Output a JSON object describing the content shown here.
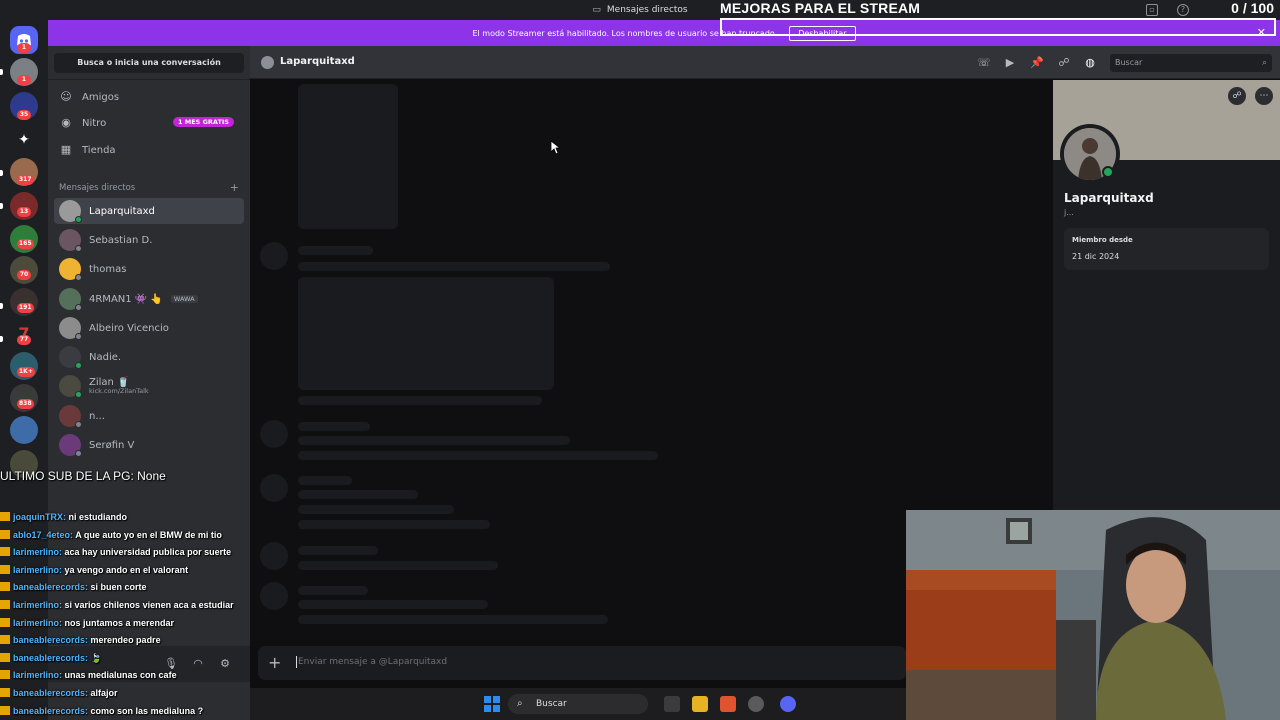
{
  "titlebar": {
    "title": "Mensajes directos"
  },
  "overlay": {
    "headline": "MEJORAS PARA EL STREAM",
    "counter": "0 / 100",
    "last_sub": "ULTIMO SUB DE LA PG: None"
  },
  "banner": {
    "text": "El modo Streamer está habilitado. Los nombres de usuario se han truncado.",
    "disable_label": "Deshabilitar"
  },
  "servers": [
    {
      "badge": "1"
    },
    {
      "badge": "1"
    },
    {
      "badge": "35"
    },
    {
      "badge": ""
    },
    {
      "badge": "317"
    },
    {
      "badge": "13"
    },
    {
      "badge": "165"
    },
    {
      "badge": "70"
    },
    {
      "badge": "191"
    },
    {
      "badge": "77"
    },
    {
      "badge": "1K+"
    },
    {
      "badge": "838"
    },
    {
      "badge": ""
    }
  ],
  "sidebar": {
    "search_label": "Busca o inicia una conversación",
    "nav": {
      "friends": "Amigos",
      "nitro": "Nitro",
      "nitro_badge": "1 MES GRATIS",
      "shop": "Tienda"
    },
    "dm_header": "Mensajes directos",
    "dm_add": "+",
    "dms": [
      {
        "name": "Laparquitaxd",
        "sub": "",
        "tag": ""
      },
      {
        "name": "Sebastian D.",
        "sub": "",
        "tag": ""
      },
      {
        "name": "thomas",
        "sub": "",
        "tag": ""
      },
      {
        "name": "4RMAN1 👾 👆",
        "sub": "",
        "tag": "WAWA"
      },
      {
        "name": "Albeiro Vicencio",
        "sub": "",
        "tag": ""
      },
      {
        "name": "Nadie.",
        "sub": "",
        "tag": ""
      },
      {
        "name": "Zilan 🥤",
        "sub": "kick.com/ZilanTalk",
        "tag": ""
      },
      {
        "name": "n...",
        "sub": "",
        "tag": ""
      },
      {
        "name": "Serøfin V",
        "sub": "",
        "tag": ""
      }
    ]
  },
  "stream_chat": [
    {
      "user": "joaquinTRX:",
      "msg": "ni estudiando"
    },
    {
      "user": "ablo17_4eteo:",
      "msg": "A que auto yo en el BMW de mi tio"
    },
    {
      "user": "larimerlino:",
      "msg": "aca hay universidad publica por suerte"
    },
    {
      "user": "larimerlino:",
      "msg": "ya vengo ando en el valorant"
    },
    {
      "user": "baneablerecords:",
      "msg": "si buen corte"
    },
    {
      "user": "larimerlino:",
      "msg": "si varios chilenos vienen aca a estudiar"
    },
    {
      "user": "larimerlino:",
      "msg": "nos juntamos a merendar"
    },
    {
      "user": "baneablerecords:",
      "msg": "merendeo padre"
    },
    {
      "user": "baneablerecords:",
      "msg": "🍃"
    },
    {
      "user": "larimerlino:",
      "msg": "unas medialunas con cafe"
    },
    {
      "user": "baneablerecords:",
      "msg": "alfajor"
    },
    {
      "user": "baneablerecords:",
      "msg": "como son las medialuna ?"
    }
  ],
  "channel": {
    "name": "Laparquitaxd",
    "search_placeholder": "Buscar",
    "composer_placeholder": "Enviar mensaje a @Laparquitaxd"
  },
  "profile": {
    "name": "Laparquitaxd",
    "status": "j...",
    "member_since_label": "Miembro desde",
    "member_since": "21 dic 2024"
  },
  "taskbar": {
    "search_label": "Buscar"
  },
  "colors": {
    "accent": "#8d33e8",
    "online": "#23a55a",
    "badge": "#f23f43"
  }
}
